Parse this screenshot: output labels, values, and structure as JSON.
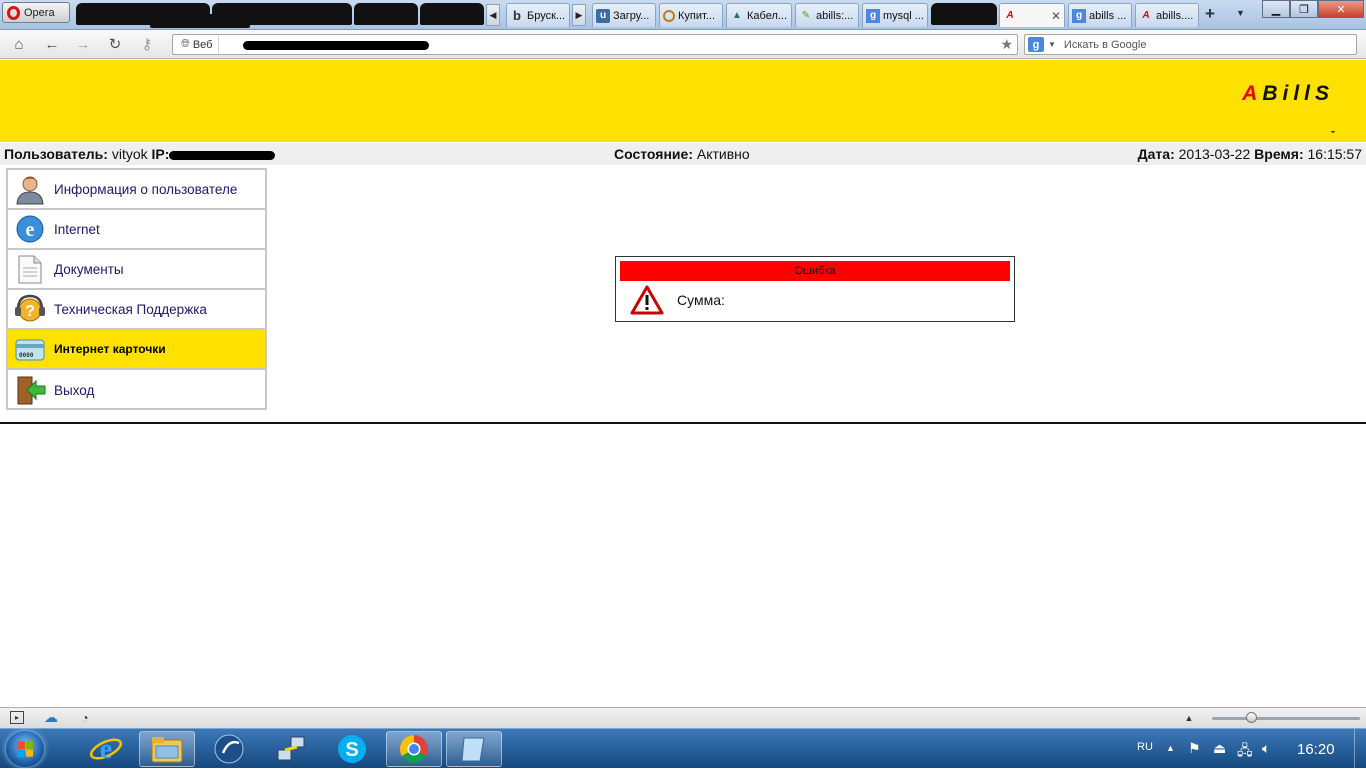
{
  "browser": {
    "opera_button_label": "Opera",
    "tabs": [
      {
        "label": "Бруск...",
        "favicon": "b"
      },
      {
        "label": "Загру...",
        "favicon": "u"
      },
      {
        "label": "Купит...",
        "favicon": "o"
      },
      {
        "label": "Кабел...",
        "favicon": "A"
      },
      {
        "label": "abills:...",
        "favicon": "e"
      },
      {
        "label": "mysql ...",
        "favicon": "g"
      },
      {
        "label": "abills ...",
        "favicon": "g"
      },
      {
        "label": "abills....",
        "favicon": "A"
      }
    ],
    "address_badge": "Веб",
    "search_placeholder": "Искать в Google"
  },
  "site": {
    "logo_first": "A",
    "logo_rest": "BillS",
    "header_dash": "-"
  },
  "infobar": {
    "user_label": "Пользователь:",
    "user_value": "vityok",
    "ip_label": "IP:",
    "status_label": "Состояние:",
    "status_value": "Активно",
    "date_label": "Дата:",
    "date_value": "2013-03-22",
    "time_label": "Время:",
    "time_value": "16:15:57"
  },
  "menu": {
    "items": [
      {
        "label": "Информация о пользователе",
        "icon": "user-icon"
      },
      {
        "label": "Internet",
        "icon": "internet-explorer-icon"
      },
      {
        "label": "Документы",
        "icon": "document-icon"
      },
      {
        "label": "Техническая Поддержка",
        "icon": "support-headset-icon"
      },
      {
        "label": "Интернет карточки",
        "icon": "card-icon",
        "active": true
      },
      {
        "label": "Выход",
        "icon": "exit-door-icon"
      }
    ]
  },
  "error": {
    "title": "Ошибка",
    "message": "Сумма:"
  },
  "taskbar": {
    "language": "RU",
    "clock": "16:20"
  },
  "colors": {
    "header_yellow": "#ffe100",
    "error_red": "#ff0000",
    "logo_red": "#ee0000"
  }
}
